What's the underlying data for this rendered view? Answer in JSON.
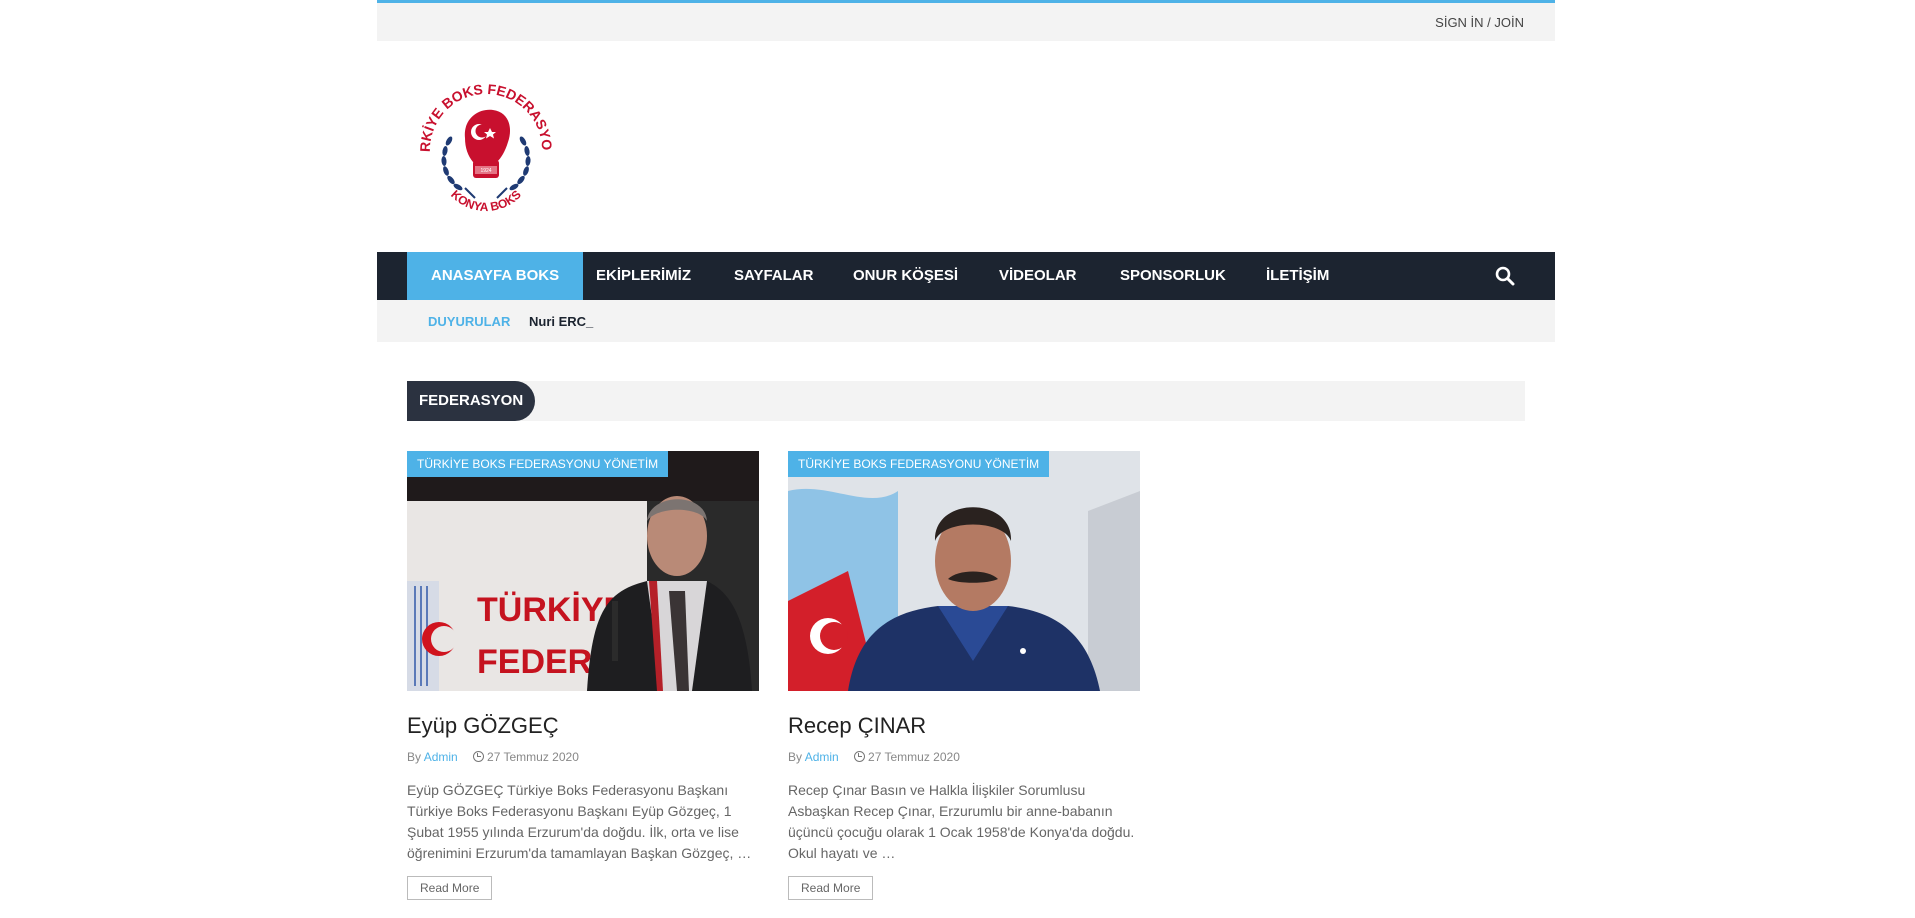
{
  "topbar": {
    "signin_label": "SİGN İN / JOİN"
  },
  "logo": {
    "top_text": "TÜRKİYE BOKS FEDERASYONU",
    "bottom_text": "KONYA BOKS",
    "year": "1924"
  },
  "nav": {
    "items": [
      {
        "label": "ANASAYFA BOKS",
        "active": true
      },
      {
        "label": "EKİPLERİMİZ"
      },
      {
        "label": "SAYFALAR"
      },
      {
        "label": "ONUR KÖŞESİ"
      },
      {
        "label": "VİDEOLAR"
      },
      {
        "label": "SPONSORLUK"
      },
      {
        "label": "İLETİŞİM"
      }
    ],
    "search_icon": "search-icon"
  },
  "ticker": {
    "label": "DUYURULAR",
    "text": "Nuri ERC_"
  },
  "section": {
    "title": "FEDERASYON"
  },
  "posts": [
    {
      "category": "TÜRKİYE BOKS FEDERASYONU YÖNETİM",
      "title": "Eyüp GÖZGEÇ",
      "by": "By",
      "author": "Admin",
      "date": "27 Temmuz 2020",
      "excerpt": "Eyüp GÖZGEÇ Türkiye Boks Federasyonu Başkanı Türkiye Boks Federasyonu Başkanı Eyüp Gözgeç, 1 Şubat 1955 yılında Erzurum'da doğdu. İlk, orta ve lise öğrenimini Erzurum'da tamamlayan Başkan Gözgeç, …",
      "read_more": "Read More",
      "image_text_1": "TÜRKİYE",
      "image_text_2": "FEDERAS"
    },
    {
      "category": "TÜRKİYE BOKS FEDERASYONU YÖNETİM",
      "title": "Recep ÇINAR",
      "by": "By",
      "author": "Admin",
      "date": "27 Temmuz 2020",
      "excerpt": "Recep Çınar Basın ve Halkla İlişkiler Sorumlusu Asbaşkan Recep Çınar, Erzurumlu bir anne-babanın üçüncü çocuğu olarak 1 Ocak 1958'de Konya'da doğdu. Okul hayatı ve …",
      "read_more": "Read More"
    }
  ],
  "colors": {
    "accent": "#4eb2e7",
    "nav_bg": "#1c2430",
    "section_title_bg": "#2b3240",
    "logo_red": "#c8102e",
    "logo_navy": "#1f3a73"
  }
}
